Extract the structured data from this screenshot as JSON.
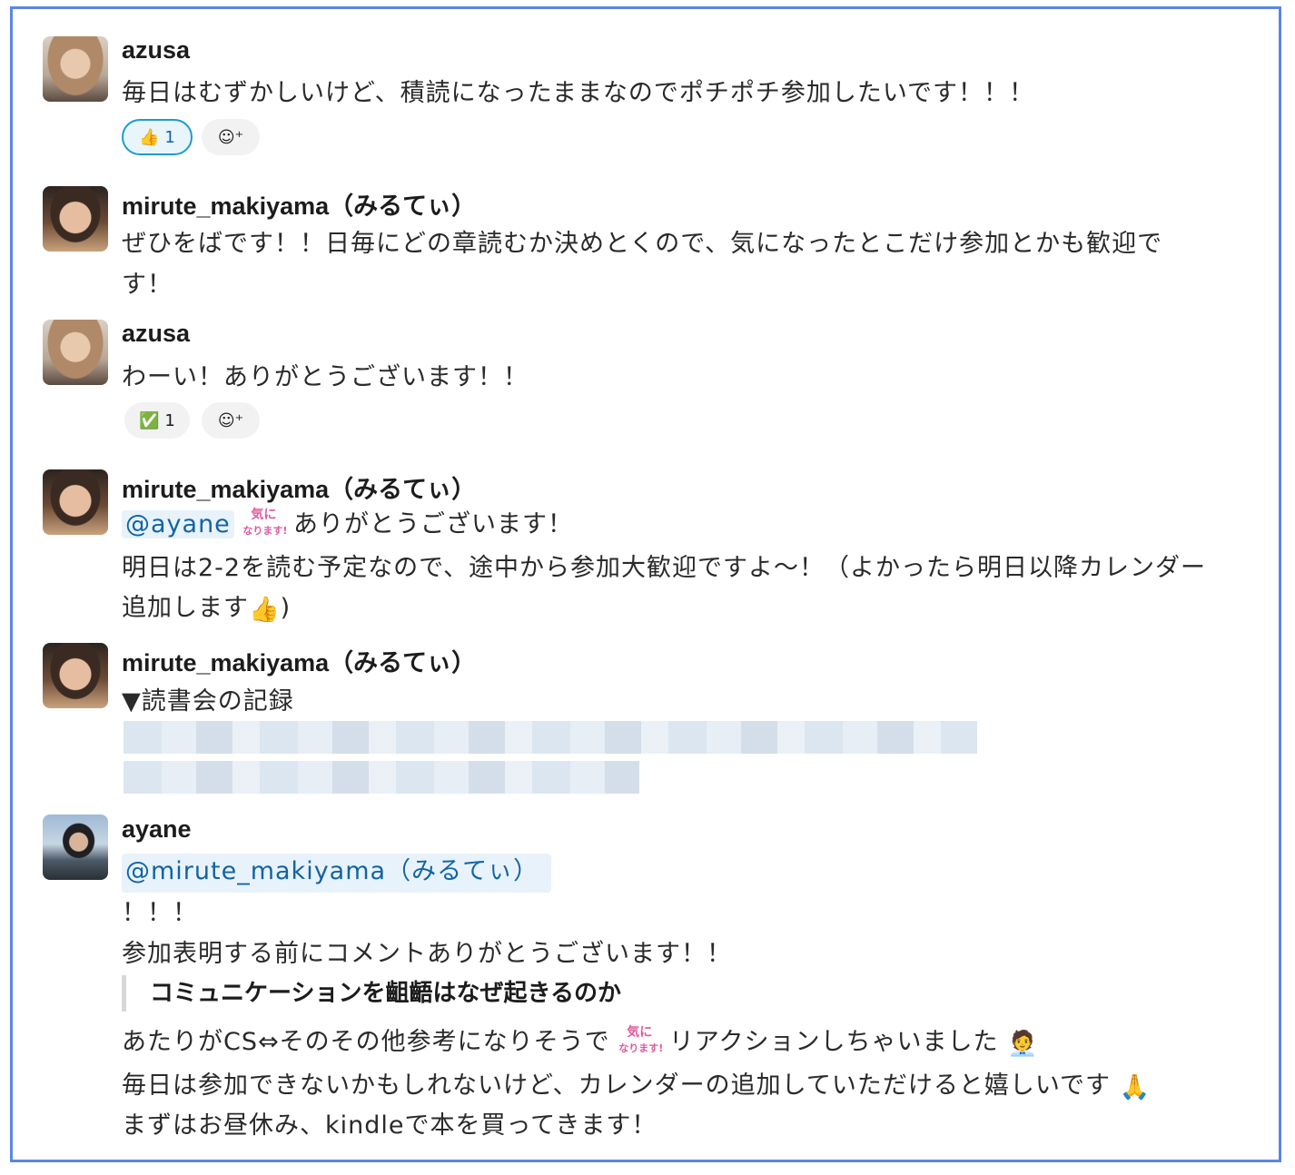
{
  "messages": {
    "m1": {
      "author": "azusa",
      "lines": [
        "毎日はむずかしいけど、積読になったままなのでポチポチ参加したいです！！！"
      ],
      "reaction": {
        "emoji": "thumbs-up",
        "count": "1"
      }
    },
    "m2": {
      "author": "mirute_makiyama（みるてぃ）",
      "lines": [
        "ぜひをばです！！日毎にどの章読むか決めとくので、気になったとこだけ参加とかも歓迎で",
        "す！"
      ]
    },
    "m3": {
      "author": "azusa",
      "lines": [
        "わーい！ありがとうございます！！"
      ],
      "reaction": {
        "emoji": "check-mark",
        "count": "1"
      }
    },
    "m4": {
      "author": "mirute_makiyama（みるてぃ）",
      "mention": "@ayane",
      "line1_after": "ありがとうございます！",
      "line2": "明日は2-2を読む予定なので、途中から参加大歓迎ですよ〜！（よかったら明日以降カレンダー",
      "line3": "追加します",
      "line3_end": ")"
    },
    "m5": {
      "author": "mirute_makiyama（みるてぃ）",
      "line1": "▼読書会の記録"
    },
    "m6": {
      "author": "ayane",
      "mention": "@mirute_makiyama（みるてぃ）",
      "line2": "！！！",
      "line3": "参加表明する前にコメントありがとうございます！！",
      "quote": "コミュニケーションを齟齬はなぜ起きるのか",
      "line5_before": "あたりがCS⇔そのその他参考になりそうで",
      "line5_after": "リアクションしちゃいました",
      "line6": "毎日は参加できないかもしれないけど、カレンダーの追加していただけると嬉しいです",
      "line7": "まずはお昼休み、kindleで本を買ってきます！"
    },
    "emoji_ki_text": [
      "気に",
      "なります!"
    ]
  }
}
